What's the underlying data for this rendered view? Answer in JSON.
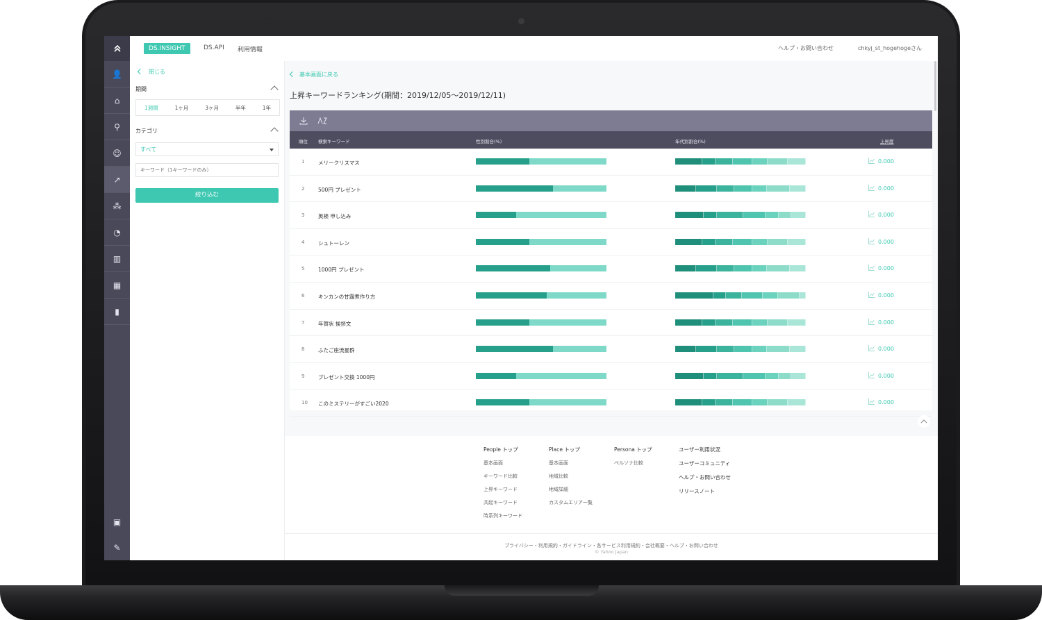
{
  "topbar": {
    "brand": "DS.INSIGHT",
    "nav": [
      "DS.API",
      "利用情報"
    ],
    "help": "ヘルプ・お問い合わせ",
    "user": "chkyj_st_hogehogeさん"
  },
  "sidebar": {
    "close_label": "閉じる",
    "period_title": "期間",
    "period_options": [
      "1週間",
      "1ヶ月",
      "3ヶ月",
      "半年",
      "1年"
    ],
    "period_selected": 0,
    "category_title": "カテゴリ",
    "category_value": "すべて",
    "keyword_placeholder": "キーワード（1キーワードのみ）",
    "filter_button": "絞り込む"
  },
  "rail": {
    "icons": [
      "up-arrow-icon",
      "people-icon",
      "home-icon",
      "place-icon",
      "persona-icon",
      "rising-keyword-icon",
      "cooccur-icon",
      "timeseries-icon",
      "compare-icon",
      "area-icon",
      "chart-icon"
    ],
    "bottom_icons": [
      "guide-icon",
      "memo-icon"
    ],
    "active_index": 5
  },
  "main": {
    "back_label": "基本画面に戻る",
    "title": "上昇キーワードランキング(期間：2019/12/05〜2019/12/11)",
    "columns": {
      "rank": "順位",
      "keyword": "検索キーワード",
      "gender": "性別割合(%)",
      "age": "年代別割合(%)",
      "rise": "上昇度"
    },
    "rows": [
      {
        "rank": "1",
        "keyword": "メリークリスマス",
        "gender_male": 0.41,
        "age": [
          0.21,
          0.1,
          0.13,
          0.15,
          0.12,
          0.15,
          0.14
        ],
        "rise": "0.000"
      },
      {
        "rank": "2",
        "keyword": "500円 プレゼント",
        "gender_male": 0.59,
        "age": [
          0.16,
          0.16,
          0.13,
          0.14,
          0.11,
          0.18,
          0.12
        ],
        "rise": "0.000"
      },
      {
        "rank": "3",
        "keyword": "英検 申し込み",
        "gender_male": 0.31,
        "age": [
          0.22,
          0.1,
          0.2,
          0.17,
          0.1,
          0.1,
          0.11
        ],
        "rise": "0.000"
      },
      {
        "rank": "4",
        "keyword": "シュトーレン",
        "gender_male": 0.41,
        "age": [
          0.21,
          0.1,
          0.13,
          0.15,
          0.12,
          0.15,
          0.14
        ],
        "rise": "0.000"
      },
      {
        "rank": "5",
        "keyword": "1000円 プレゼント",
        "gender_male": 0.57,
        "age": [
          0.16,
          0.16,
          0.13,
          0.14,
          0.11,
          0.18,
          0.12
        ],
        "rise": "0.000"
      },
      {
        "rank": "6",
        "keyword": "キンカンの甘露煮作り方",
        "gender_male": 0.54,
        "age": [
          0.29,
          0.1,
          0.12,
          0.16,
          0.12,
          0.16,
          0.05
        ],
        "rise": "0.000"
      },
      {
        "rank": "7",
        "keyword": "年賀状 挨拶文",
        "gender_male": 0.41,
        "age": [
          0.21,
          0.1,
          0.13,
          0.15,
          0.12,
          0.15,
          0.14
        ],
        "rise": "0.000"
      },
      {
        "rank": "8",
        "keyword": "ふたご座流星群",
        "gender_male": 0.59,
        "age": [
          0.16,
          0.16,
          0.13,
          0.14,
          0.11,
          0.18,
          0.12
        ],
        "rise": "0.000"
      },
      {
        "rank": "9",
        "keyword": "プレゼント交換 1000円",
        "gender_male": 0.31,
        "age": [
          0.22,
          0.1,
          0.2,
          0.17,
          0.1,
          0.1,
          0.11
        ],
        "rise": "0.000"
      },
      {
        "rank": "10",
        "keyword": "このミステリーがすごい2020",
        "gender_male": 0.41,
        "age": [
          0.21,
          0.1,
          0.13,
          0.15,
          0.12,
          0.15,
          0.14
        ],
        "rise": "0.000"
      }
    ]
  },
  "colors": {
    "accent": "#3ec8b1",
    "male": "#26a08a",
    "female": "#7ed9c8",
    "age_palette": [
      "#1f8f7b",
      "#26a08a",
      "#3bb39d",
      "#4fc4ae",
      "#6bd2be",
      "#8ddcca",
      "#a9e6d8"
    ],
    "header_dark": "#4e4d60",
    "header_light": "#7d7c93",
    "rail": "#4a4959"
  },
  "footer": {
    "columns": [
      {
        "head": "People トップ",
        "items": [
          "基本画面",
          "キーワード比較",
          "上昇キーワード",
          "共起キーワード",
          "時系列キーワード"
        ]
      },
      {
        "head": "Place トップ",
        "items": [
          "基本画面",
          "地域比較",
          "地域詳細",
          "カスタムエリア一覧"
        ]
      },
      {
        "head": "Persona トップ",
        "items": [
          "ペルソナ比較"
        ]
      },
      {
        "head": "ユーザー利用状況",
        "items": [
          "ユーザーコミュニティ",
          "ヘルプ・お問い合わせ",
          "リリースノート"
        ]
      }
    ],
    "links": "プライバシー・利用規約・ガイドライン・各サービス利用規約・会社概要・ヘルプ・お問い合わせ",
    "copyright": "© Yahoo Japan"
  }
}
